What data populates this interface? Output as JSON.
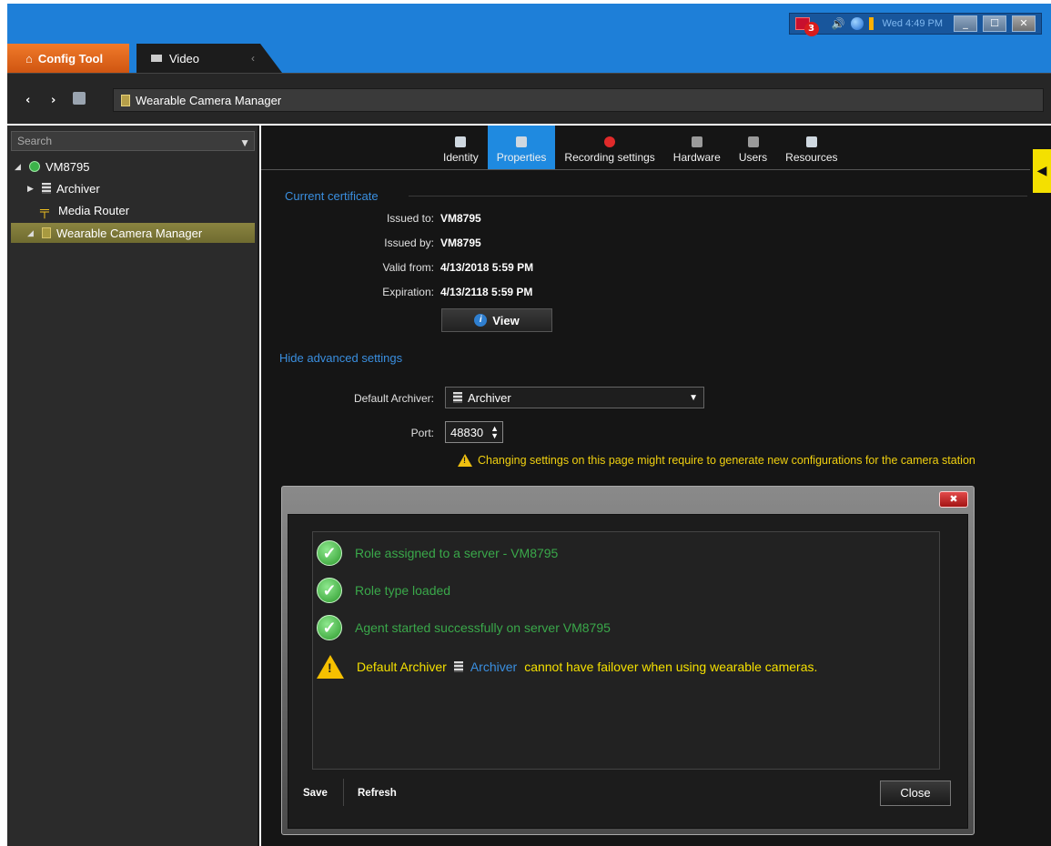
{
  "tray": {
    "alert_count": "3",
    "time": "Wed 4:49 PM"
  },
  "tabs": {
    "config_tool": "Config Tool",
    "video": "Video"
  },
  "breadcrumb": {
    "current": "Wearable Camera Manager"
  },
  "sidebar": {
    "search_placeholder": "Search",
    "tree": [
      {
        "label": "VM8795"
      },
      {
        "label": "Archiver"
      },
      {
        "label": "Media Router"
      },
      {
        "label": "Wearable Camera Manager"
      }
    ]
  },
  "toptabs": [
    {
      "label": "Identity"
    },
    {
      "label": "Properties"
    },
    {
      "label": "Recording settings"
    },
    {
      "label": "Hardware"
    },
    {
      "label": "Users"
    },
    {
      "label": "Resources"
    }
  ],
  "certificate": {
    "section_title": "Current certificate",
    "issued_to_label": "Issued to:",
    "issued_to": "VM8795",
    "issued_by_label": "Issued by:",
    "issued_by": "VM8795",
    "valid_from_label": "Valid from:",
    "valid_from": "4/13/2018 5:59 PM",
    "expiration_label": "Expiration:",
    "expiration": "4/13/2118 5:59 PM",
    "view_button": "View"
  },
  "advanced": {
    "toggle_label": "Hide advanced settings",
    "default_archiver_label": "Default Archiver:",
    "default_archiver_value": "Archiver",
    "port_label": "Port:",
    "port_value": "48830",
    "warning": "Changing settings on this page might require to generate new configurations for the camera station"
  },
  "dialog": {
    "messages": [
      {
        "type": "ok",
        "text": "Role assigned to a server - VM8795"
      },
      {
        "type": "ok",
        "text": "Role type loaded"
      },
      {
        "type": "ok",
        "text": "Agent started successfully on server VM8795"
      }
    ],
    "warning_prefix": "Default Archiver",
    "warning_link": "Archiver",
    "warning_suffix": "cannot have failover when using wearable cameras.",
    "save_button": "Save",
    "refresh_button": "Refresh",
    "close_button": "Close"
  }
}
